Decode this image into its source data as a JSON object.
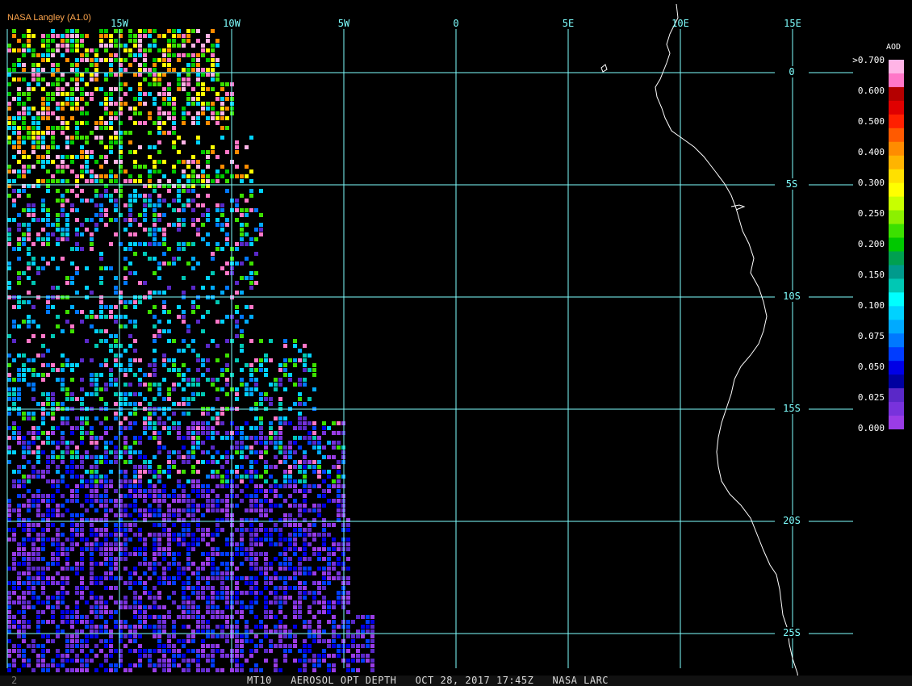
{
  "header": {
    "credit": "NASA Langley (A1.0)"
  },
  "footer": {
    "tag": "2",
    "product": "MT10   AEROSOL OPT DEPTH   OCT 28, 2017 17:45Z   NASA LARC"
  },
  "grid": {
    "color": "#7fffff",
    "longitude_labels": [
      "15W",
      "10W",
      "5W",
      "0",
      "5E",
      "10E",
      "15E"
    ],
    "latitude_labels": [
      "0",
      "5S",
      "10S",
      "15S",
      "20S",
      "25S"
    ]
  },
  "legend": {
    "title": "AOD",
    "labels": [
      ">0.700",
      "0.600",
      "0.500",
      "0.400",
      "0.300",
      "0.250",
      "0.200",
      "0.150",
      "0.100",
      "0.075",
      "0.050",
      "0.025",
      "0.000"
    ],
    "colors": [
      "#ffb4e6",
      "#ff77c8",
      "#b40000",
      "#e00000",
      "#ff2000",
      "#ff5a00",
      "#ff8c00",
      "#ffb400",
      "#ffe000",
      "#ffff00",
      "#c8ff00",
      "#8cf000",
      "#3ce000",
      "#00c800",
      "#00a050",
      "#009a8c",
      "#00c8b4",
      "#00ffff",
      "#00d2ff",
      "#00aaff",
      "#0078ff",
      "#003cff",
      "#0000e6",
      "#0000a0",
      "#5a28c8",
      "#7832dc",
      "#9a3ce6"
    ]
  },
  "coastline_color": "#ffffff",
  "aerosol_bands": [
    {
      "zone": "north",
      "palette": [
        "#ffb4e6",
        "#ff77c8",
        "#ffff00",
        "#3ce000",
        "#00c800",
        "#ff8c00",
        "#00d2ff"
      ]
    },
    {
      "zone": "mid",
      "palette": [
        "#00d2ff",
        "#00aaff",
        "#0078ff",
        "#3ce000",
        "#00c8b4",
        "#ff77c8",
        "#5a28c8"
      ]
    },
    {
      "zone": "south",
      "palette": [
        "#7832dc",
        "#5a28c8",
        "#9a3ce6",
        "#003cff",
        "#0000e6"
      ]
    }
  ]
}
